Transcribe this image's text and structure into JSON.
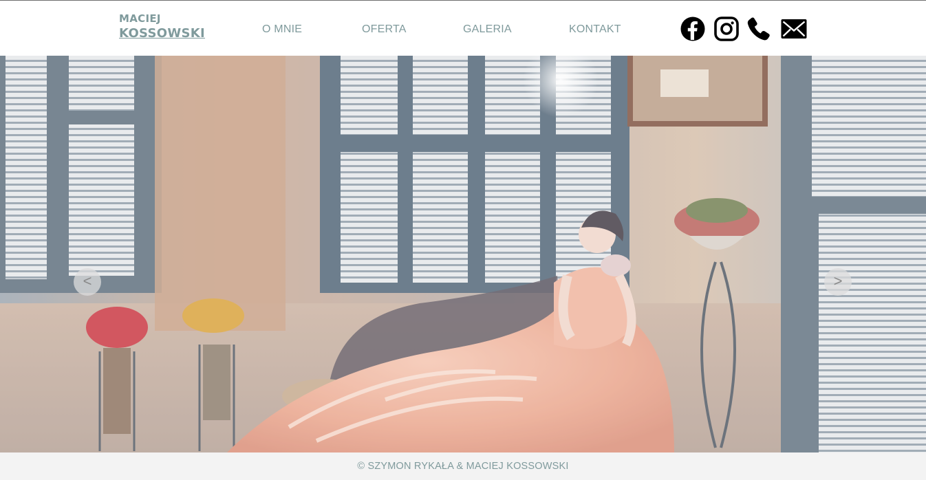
{
  "brand": {
    "line1": "MACIEJ",
    "line2": "KOSSOWSKI"
  },
  "nav": {
    "about": "O MNIE",
    "offer": "OFERTA",
    "gallery": "GALERIA",
    "contact": "KONTAKT"
  },
  "social_icons": [
    "facebook-icon",
    "instagram-icon",
    "phone-icon",
    "envelope-icon"
  ],
  "slider": {
    "prev_label": "<",
    "next_label": ">",
    "image": "bride in peach ruffled gown seated on a wicker daybed before shuttered windows"
  },
  "footer": {
    "copyright": "© SZYMON RYKAŁA & MACIEJ KOSSOWSKI"
  },
  "colors": {
    "accent": "#7f9a9c",
    "footer_bg": "#f3f3f3",
    "header_bg": "#ffffff"
  }
}
